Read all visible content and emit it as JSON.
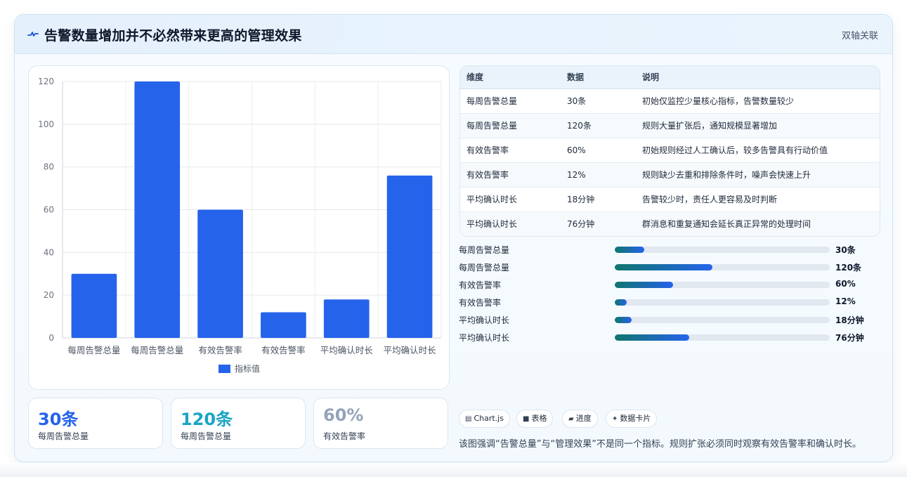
{
  "header": {
    "title": "告警数量增加并不必然带来更高的管理效果",
    "right_label": "双轴关联"
  },
  "chart_data": {
    "type": "bar",
    "categories": [
      "每周告警总量",
      "每周告警总量",
      "有效告警率",
      "有效告警率",
      "平均确认时长",
      "平均确认时长"
    ],
    "series": [
      {
        "name": "指标值",
        "values": [
          30,
          120,
          60,
          12,
          18,
          76
        ],
        "color": "#2563eb"
      }
    ],
    "ylim": [
      0,
      120
    ],
    "yticks": [
      "0",
      "20",
      "40",
      "60",
      "80",
      "100",
      "120"
    ],
    "grid": true,
    "legend": "bottom"
  },
  "stats": [
    {
      "value": "30条",
      "label": "每周告警总量",
      "color": "#2563eb"
    },
    {
      "value": "120条",
      "label": "每周告警总量",
      "color": "#1aa5c5"
    },
    {
      "value": "60%",
      "label": "有效告警率",
      "color": "#94a3b8"
    }
  ],
  "table": {
    "headers": [
      "维度",
      "数据",
      "说明"
    ],
    "rows": [
      [
        "每周告警总量",
        "30条",
        "初始仅监控少量核心指标，告警数量较少"
      ],
      [
        "每周告警总量",
        "120条",
        "规则大量扩张后，通知规模显著增加"
      ],
      [
        "有效告警率",
        "60%",
        "初始规则经过人工确认后，较多告警具有行动价值"
      ],
      [
        "有效告警率",
        "12%",
        "规则缺少去重和排除条件时，噪声会快速上升"
      ],
      [
        "平均确认时长",
        "18分钟",
        "告警较少时，责任人更容易及时判断"
      ],
      [
        "平均确认时长",
        "76分钟",
        "群消息和重复通知会延长真正异常的处理时间"
      ]
    ]
  },
  "progress": [
    {
      "label": "每周告警总量",
      "value": "30条",
      "fraction": 0.136
    },
    {
      "label": "每周告警总量",
      "value": "120条",
      "fraction": 0.455
    },
    {
      "label": "有效告警率",
      "value": "60%",
      "fraction": 0.27
    },
    {
      "label": "有效告警率",
      "value": "12%",
      "fraction": 0.054
    },
    {
      "label": "平均确认时长",
      "value": "18分钟",
      "fraction": 0.08
    },
    {
      "label": "平均确认时长",
      "value": "76分钟",
      "fraction": 0.345
    }
  ],
  "chips": [
    {
      "icon": "▤",
      "label": "Chart.js",
      "icon_name": "chart-icon"
    },
    {
      "icon": "■",
      "label": "表格",
      "icon_name": "table-icon"
    },
    {
      "icon": "▰",
      "label": "进度",
      "icon_name": "progress-icon"
    },
    {
      "icon": "✦",
      "label": "数据卡片",
      "icon_name": "card-icon"
    }
  ],
  "note": "该图强调“告警总量”与“管理效果”不是同一个指标。规则扩张必须同时观察有效告警率和确认时长。",
  "colors": {
    "accent": "#2563eb",
    "teal": "#0f766e"
  }
}
